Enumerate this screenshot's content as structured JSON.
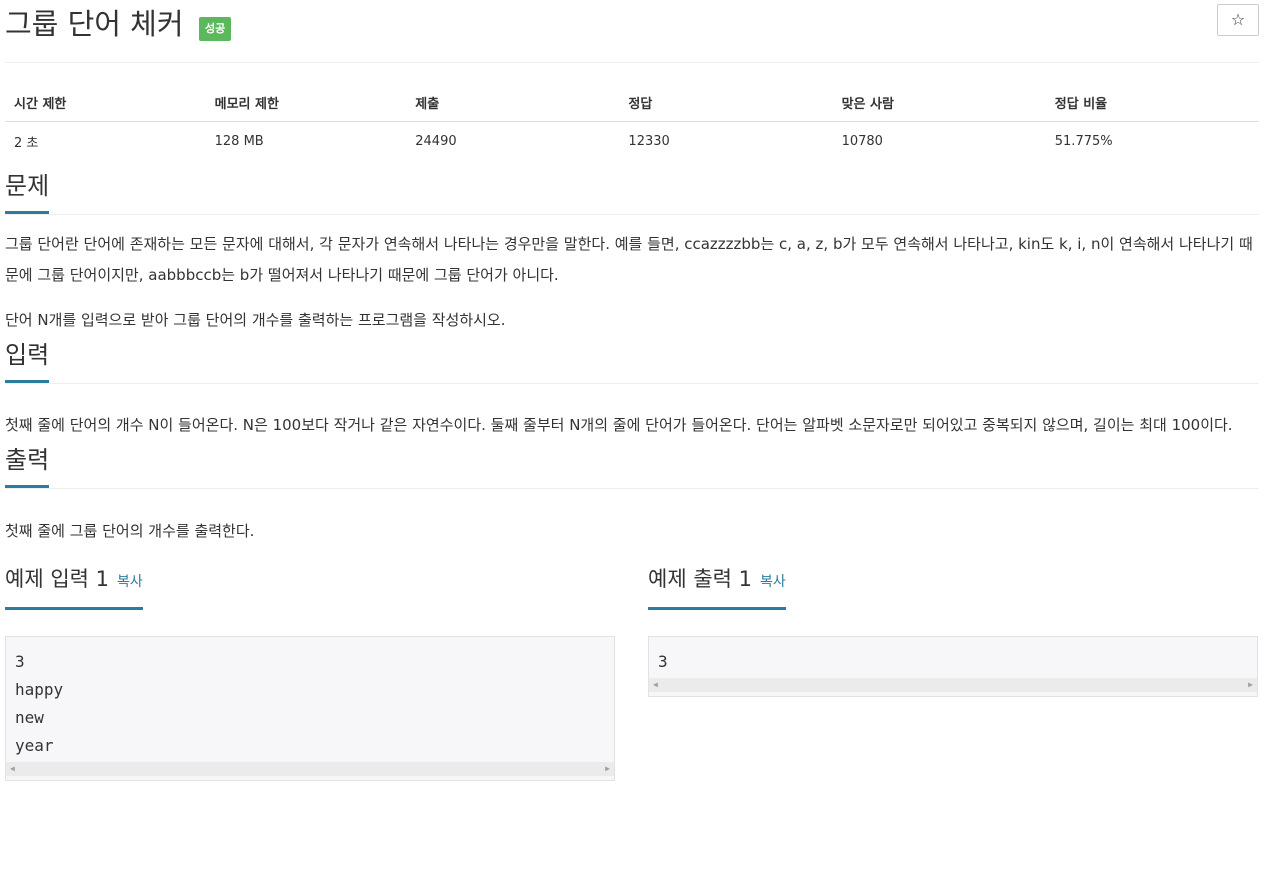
{
  "header": {
    "title": "그룹 단어 체커",
    "badge": "성공",
    "star_icon": "☆"
  },
  "info_table": {
    "headers": [
      "시간 제한",
      "메모리 제한",
      "제출",
      "정답",
      "맞은 사람",
      "정답 비율"
    ],
    "values": [
      "2 초",
      "128 MB",
      "24490",
      "12330",
      "10780",
      "51.775%"
    ]
  },
  "sections": {
    "problem": {
      "title": "문제",
      "paragraphs": [
        "그룹 단어란 단어에 존재하는 모든 문자에 대해서, 각 문자가 연속해서 나타나는 경우만을 말한다. 예를 들면, ccazzzzbb는 c, a, z, b가 모두 연속해서 나타나고, kin도 k, i, n이 연속해서 나타나기 때문에 그룹 단어이지만, aabbbccb는 b가 떨어져서 나타나기 때문에 그룹 단어가 아니다.",
        "단어 N개를 입력으로 받아 그룹 단어의 개수를 출력하는 프로그램을 작성하시오."
      ]
    },
    "input": {
      "title": "입력",
      "paragraphs": [
        "첫째 줄에 단어의 개수 N이 들어온다. N은 100보다 작거나 같은 자연수이다. 둘째 줄부터 N개의 줄에 단어가 들어온다. 단어는 알파벳 소문자로만 되어있고 중복되지 않으며, 길이는 최대 100이다."
      ]
    },
    "output": {
      "title": "출력",
      "paragraphs": [
        "첫째 줄에 그룹 단어의 개수를 출력한다."
      ]
    }
  },
  "samples": {
    "input": {
      "title": "예제 입력 1",
      "copy_label": "복사",
      "content": "3\nhappy\nnew\nyear"
    },
    "output": {
      "title": "예제 출력 1",
      "copy_label": "복사",
      "content": "3"
    }
  },
  "colors": {
    "badge_green": "#5cb85c",
    "accent_blue": "#2a7ca0"
  }
}
